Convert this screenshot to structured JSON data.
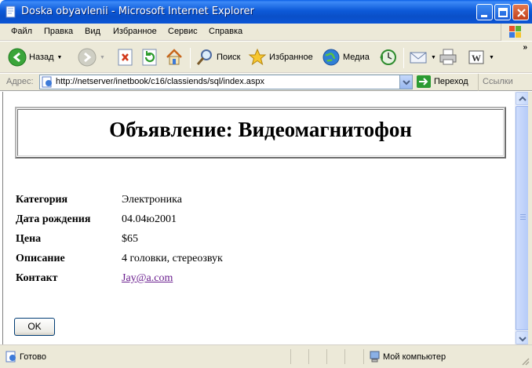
{
  "window": {
    "title": "Doska obyavlenii - Microsoft Internet Explorer",
    "controls": {
      "minimize": "minimize",
      "maximize": "maximize",
      "close": "close"
    }
  },
  "menu": {
    "items": [
      "Файл",
      "Правка",
      "Вид",
      "Избранное",
      "Сервис",
      "Справка"
    ]
  },
  "toolbar": {
    "back": "Назад",
    "search": "Поиск",
    "favorites": "Избранное",
    "media": "Медиа",
    "more": "»"
  },
  "address": {
    "label": "Адрес:",
    "url": "http://netserver/inetbook/c16/classiends/sql/index.aspx",
    "go": "Переход",
    "links": "Ссылки"
  },
  "page": {
    "headline": "Объявление: Видеомагнитофон",
    "fields": [
      {
        "key": "Категория",
        "value": "Электроника"
      },
      {
        "key": "Дата рождения",
        "value": "04.04ю2001"
      },
      {
        "key": "Цена",
        "value": "$65"
      },
      {
        "key": "Описание",
        "value": "4 головки, стереозвук"
      },
      {
        "key": "Контакт",
        "value": "Jay@a.com"
      }
    ],
    "ok_button": "OK"
  },
  "status": {
    "text": "Готово",
    "zone": "Мой компьютер"
  },
  "colors": {
    "titlebar": "#0a4fc8",
    "chrome": "#ece9d8",
    "link_visited": "#6b1f8f"
  }
}
